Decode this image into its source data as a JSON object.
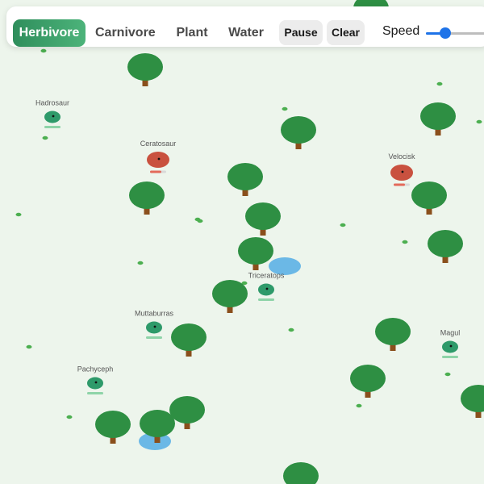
{
  "toolbar": {
    "tools": [
      "Herbivore",
      "Carnivore",
      "Plant",
      "Water"
    ],
    "active_tool": "Herbivore",
    "pause_label": "Pause",
    "clear_label": "Clear",
    "speed_label": "Speed",
    "speed_value": 0.3,
    "accent_color": "#3a9e67",
    "slider_color": "#1e73e8"
  },
  "colors": {
    "background": "#edf5ec",
    "tree_canopy": "#2e8f43",
    "tree_trunk": "#8a4f1c",
    "herbivore": "#2e9a6a",
    "carnivore": "#c9513f",
    "water": "#6bb8e6",
    "grass": "#4caf50"
  },
  "creatures": [
    {
      "name": "Hadrosaur",
      "kind": "herbivore",
      "health": 1.0
    },
    {
      "name": "Ceratosaur",
      "kind": "carnivore",
      "health": 0.7
    },
    {
      "name": "Velocisk",
      "kind": "carnivore",
      "health": 0.7
    },
    {
      "name": "Triceratops",
      "kind": "herbivore",
      "health": 1.0
    },
    {
      "name": "Muttaburras",
      "kind": "herbivore",
      "health": 1.0
    },
    {
      "name": "Magul",
      "kind": "herbivore",
      "health": 1.0
    },
    {
      "name": "Pachyceph",
      "kind": "herbivore",
      "health": 1.0
    }
  ]
}
